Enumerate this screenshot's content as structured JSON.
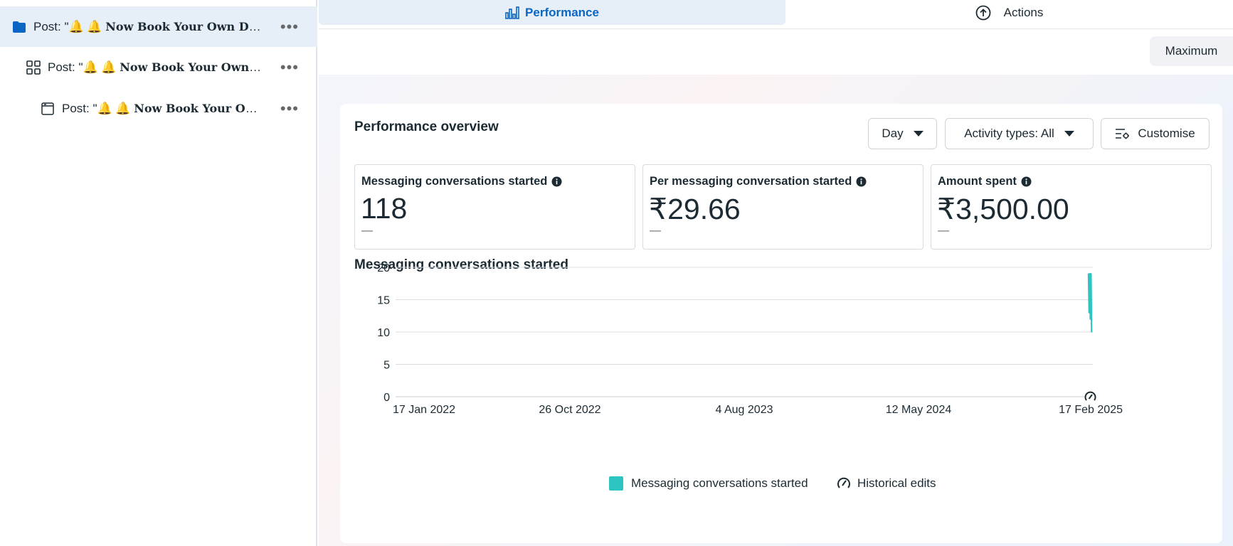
{
  "sidebar": {
    "items": [
      {
        "prefix": "Post: \"",
        "bells": "🔔 🔔",
        "title": "Now Book Your Own Drea..."
      },
      {
        "prefix": "Post: \"",
        "bells": "🔔 🔔",
        "title": "Now Book Your Own Dr..."
      },
      {
        "prefix": "Post: \"",
        "bells": "🔔 🔔",
        "title": "Now Book Your Own ..."
      }
    ],
    "more_label": "•••"
  },
  "tabs": {
    "performance": "Performance",
    "actions": "Actions"
  },
  "toolbar": {
    "date_range": "Maximum"
  },
  "overview": {
    "title": "Performance overview",
    "day_label": "Day",
    "activity_label": "Activity types: All",
    "customise_label": "Customise"
  },
  "metrics": [
    {
      "label": "Messaging conversations started",
      "value": "118",
      "delta": "—"
    },
    {
      "label": "Per messaging conversation started",
      "value": "₹29.66",
      "delta": "—"
    },
    {
      "label": "Amount spent",
      "value": "₹3,500.00",
      "delta": "—"
    }
  ],
  "chart_data": {
    "type": "line",
    "title": "Messaging conversations started",
    "xlabel": "",
    "ylabel": "",
    "ylim": [
      0,
      20
    ],
    "yticks": [
      0,
      5,
      10,
      15,
      20
    ],
    "xticks": [
      "17 Jan 2022",
      "26 Oct 2022",
      "4 Aug 2023",
      "12 May 2024",
      "17 Feb 2025"
    ],
    "xlim": [
      "2022-01-17",
      "2025-02-17"
    ],
    "grid": true,
    "legend_position": "bottom",
    "series": [
      {
        "name": "Messaging conversations started",
        "color": "#2ec4c1",
        "x": [
          "2025-02-10",
          "2025-02-11",
          "2025-02-12",
          "2025-02-13",
          "2025-02-14",
          "2025-02-15"
        ],
        "y": [
          19,
          13,
          19,
          12,
          19,
          10
        ]
      }
    ],
    "annotations": [
      {
        "label": "Historical edits",
        "icon": "historical-edits-icon",
        "x": "2025-02-13"
      }
    ]
  },
  "legend": {
    "series_label": "Messaging conversations started",
    "edits_label": "Historical edits"
  }
}
